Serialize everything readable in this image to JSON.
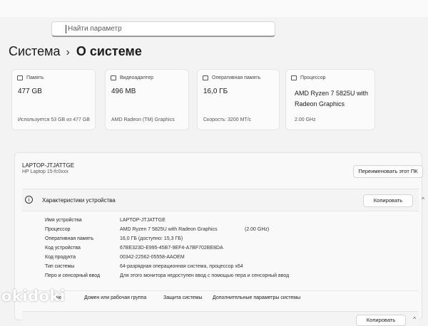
{
  "search": {
    "placeholder": "Найти параметр"
  },
  "breadcrumb": {
    "parent": "Система",
    "separator": "›",
    "current": "О системе"
  },
  "cards": [
    {
      "title": "Память",
      "value": "477 GB",
      "sub": "Используется 53 GB из 477 GB",
      "icon": "drive-icon"
    },
    {
      "title": "Видеоадаптер",
      "value": "496 MB",
      "sub": "AMD Radeon (TM) Graphics",
      "icon": "display-adapter-icon"
    },
    {
      "title": "Оперативная память",
      "value": "16,0 ГБ",
      "sub": "Скорость: 3200 МТ/с",
      "icon": "ram-icon"
    },
    {
      "title": "Процессор",
      "value": "AMD Ryzen 7 5825U with Radeon Graphics",
      "sub": "2.00 GHz",
      "icon": "cpu-icon"
    }
  ],
  "device": {
    "name": "LAPTOP-JTJATTGE",
    "model": "HP Laptop 15-fc0xxx",
    "rename_label": "Переименовать этот ПК"
  },
  "specs": {
    "title": "Характеристики устройства",
    "copy_label": "Копировать",
    "rows": [
      {
        "label": "Имя устройства",
        "value": "LAPTOP-JTJATTGE",
        "extra": ""
      },
      {
        "label": "Процессор",
        "value": "AMD Ryzen 7 5825U with Radeon Graphics",
        "extra": "(2.00 GHz)"
      },
      {
        "label": "Оперативная память",
        "value": "16,0 ГБ (доступно: 15,3 ГБ)",
        "extra": ""
      },
      {
        "label": "Код устройства",
        "value": "67BE323D-E995-45B7-9EF4-A7BF702BE8DA",
        "extra": ""
      },
      {
        "label": "Код продукта",
        "value": "00342-22562-05558-AAOEM",
        "extra": ""
      },
      {
        "label": "Тип системы",
        "value": "64-разрядная операционная система, процессор x64",
        "extra": ""
      },
      {
        "label": "Перо и сенсорный ввод",
        "value": "Для этого монитора недоступен ввод с помощью пера и сенсорный ввод",
        "extra": ""
      }
    ]
  },
  "related_links": [
    "не",
    "Домен или рабочая группа",
    "Защита системы",
    "Дополнительные параметры системы"
  ],
  "bottom": {
    "copy_label": "Копировать"
  },
  "watermark": "okidoki"
}
